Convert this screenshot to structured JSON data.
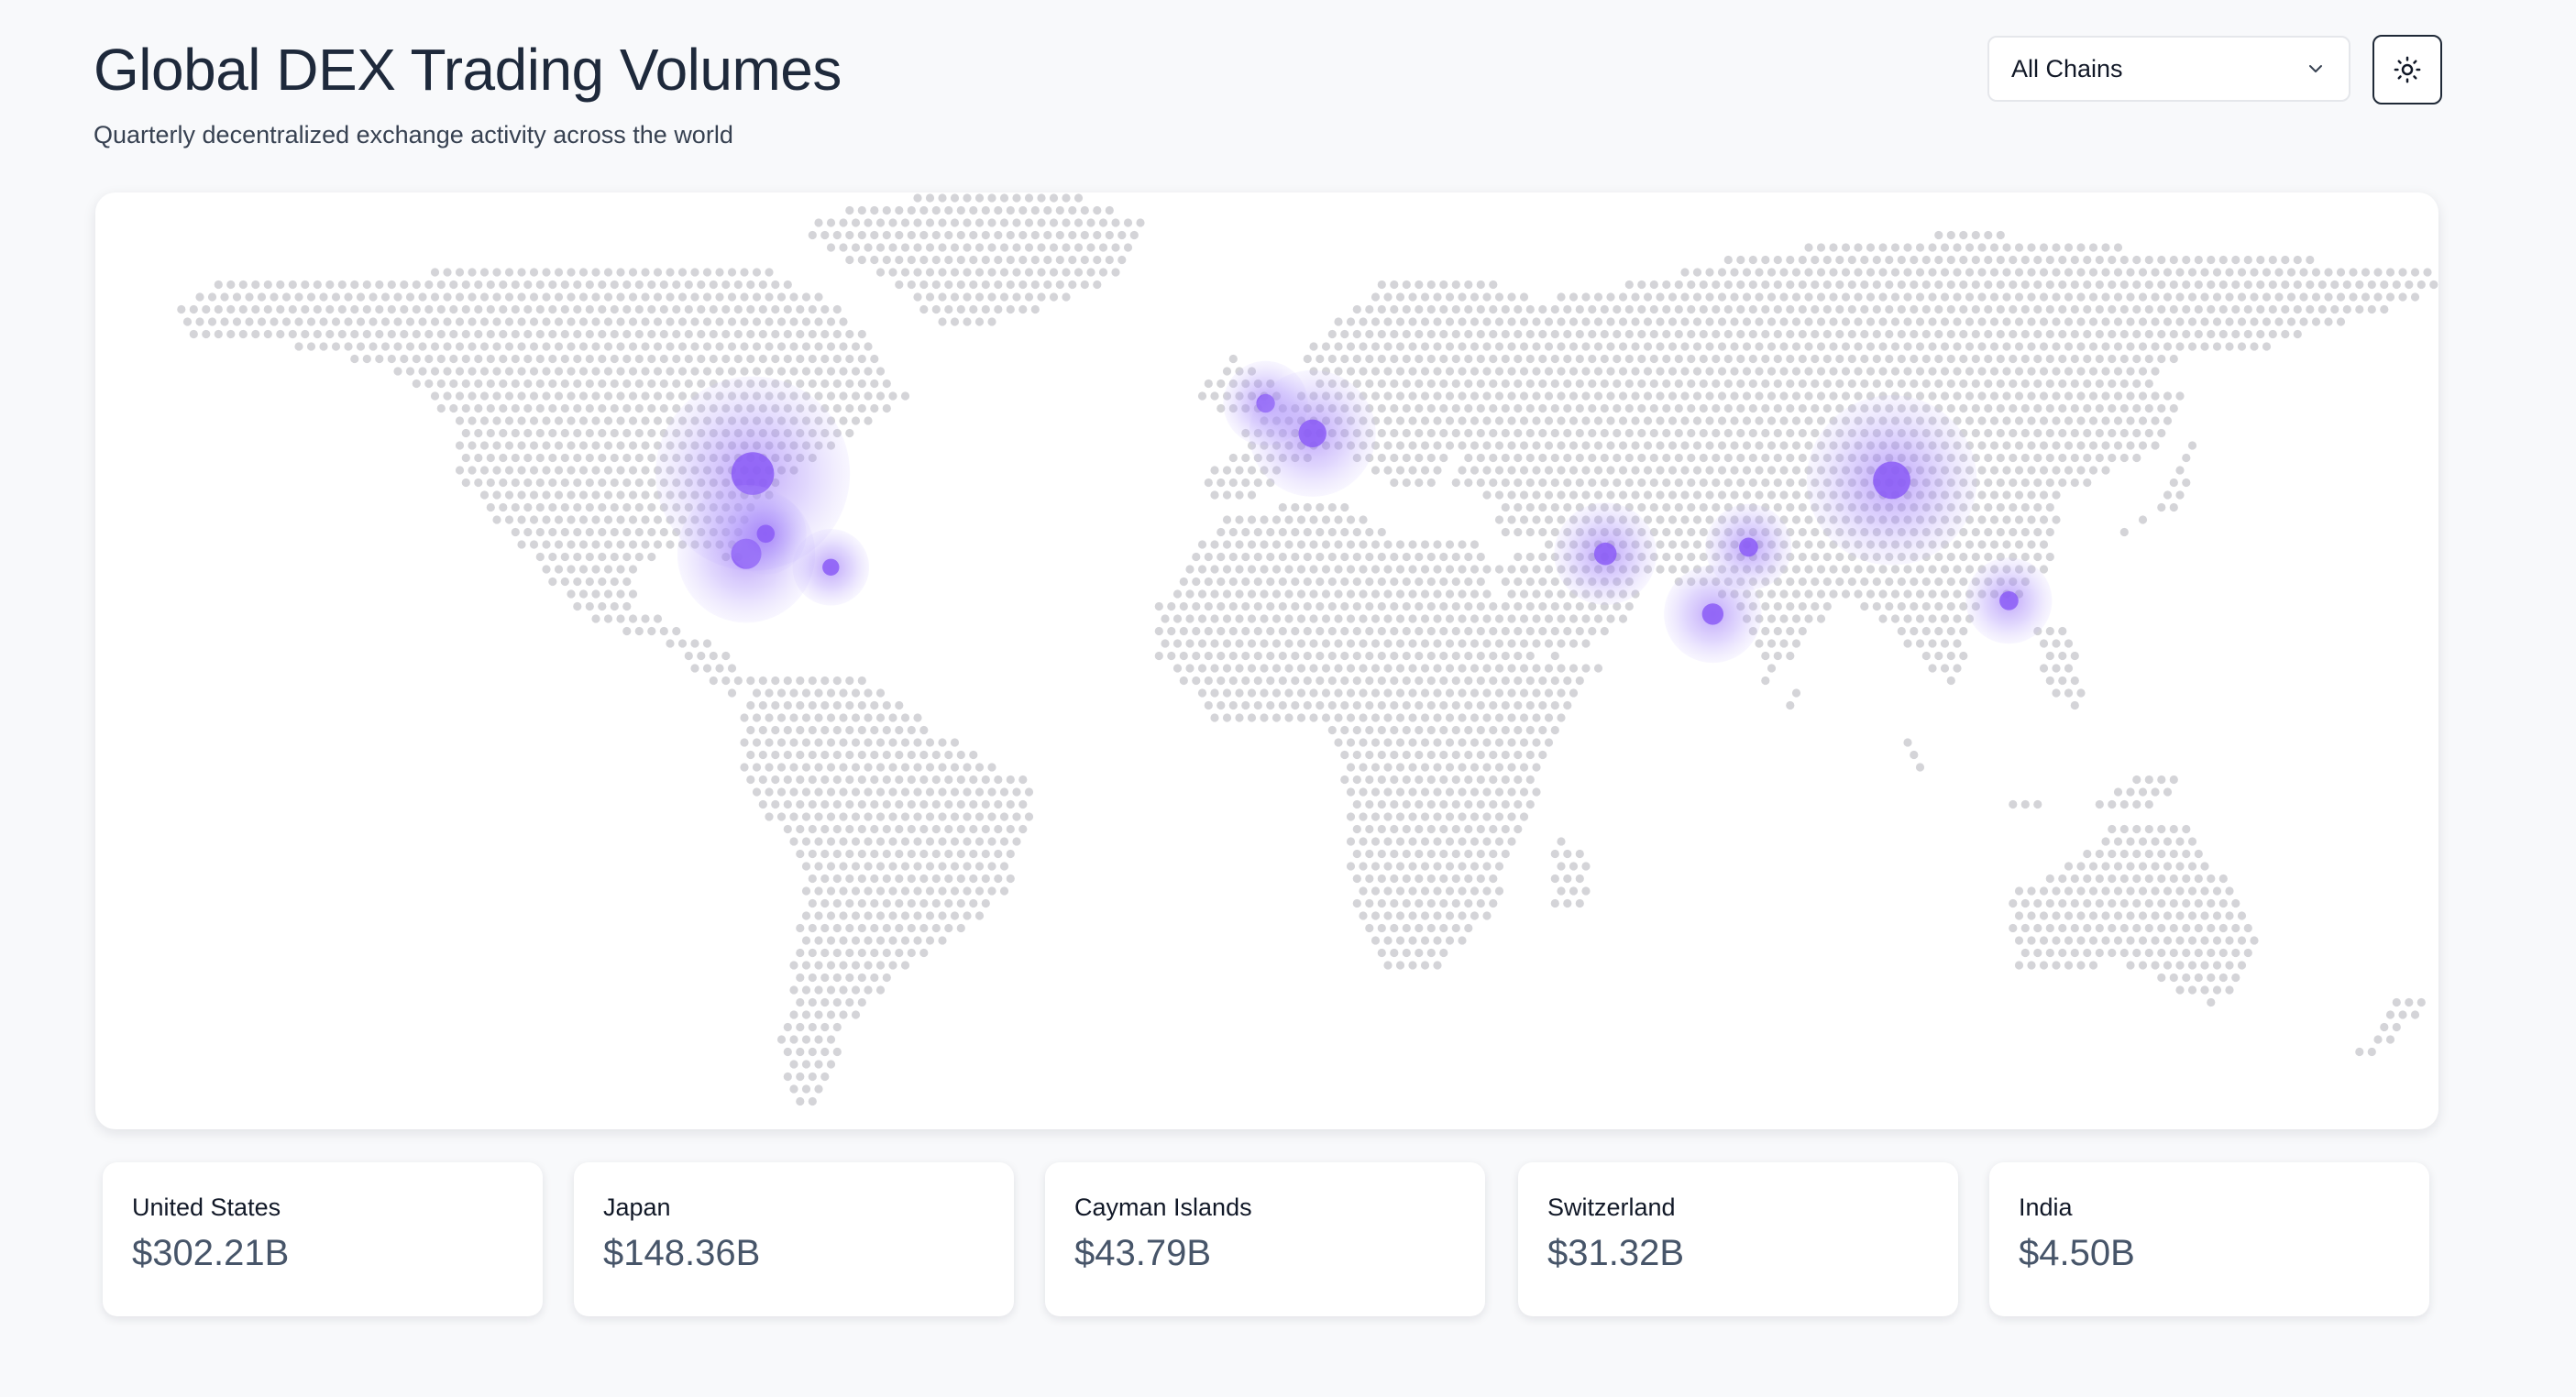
{
  "header": {
    "title": "Global DEX Trading Volumes",
    "subtitle": "Quarterly decentralized exchange activity across the world"
  },
  "controls": {
    "chain_select_value": "All Chains",
    "chain_select_icon": "chevron-down-icon",
    "theme_toggle_icon": "sun-icon"
  },
  "map": {
    "land_dot_color": "#d4d4d8",
    "bubble_color": "#8b5cf6",
    "hotspots": [
      {
        "name": "United States (north-east)",
        "lon": -79,
        "lat": 41,
        "size": 1.0
      },
      {
        "name": "United States (south-east)",
        "lon": -80,
        "lat": 29,
        "size": 0.65
      },
      {
        "name": "United States (east coast)",
        "lon": -77,
        "lat": 32,
        "size": 0.3
      },
      {
        "name": "Cayman Islands",
        "lon": -67,
        "lat": 27,
        "size": 0.27
      },
      {
        "name": "United Kingdom",
        "lon": -0.2,
        "lat": 51.5,
        "size": 0.32
      },
      {
        "name": "Switzerland",
        "lon": 7,
        "lat": 47,
        "size": 0.58
      },
      {
        "name": "Middle East",
        "lon": 52,
        "lat": 29,
        "size": 0.43
      },
      {
        "name": "India (north)",
        "lon": 74,
        "lat": 30,
        "size": 0.33
      },
      {
        "name": "India",
        "lon": 68.5,
        "lat": 20,
        "size": 0.4
      },
      {
        "name": "East Asia",
        "lon": 96,
        "lat": 40,
        "size": 0.85
      },
      {
        "name": "Japan",
        "lon": 114,
        "lat": 22,
        "size": 0.33
      }
    ]
  },
  "stats": [
    {
      "country": "United States",
      "value": "$302.21B"
    },
    {
      "country": "Japan",
      "value": "$148.36B"
    },
    {
      "country": "Cayman Islands",
      "value": "$43.79B"
    },
    {
      "country": "Switzerland",
      "value": "$31.32B"
    },
    {
      "country": "India",
      "value": "$4.50B"
    }
  ]
}
